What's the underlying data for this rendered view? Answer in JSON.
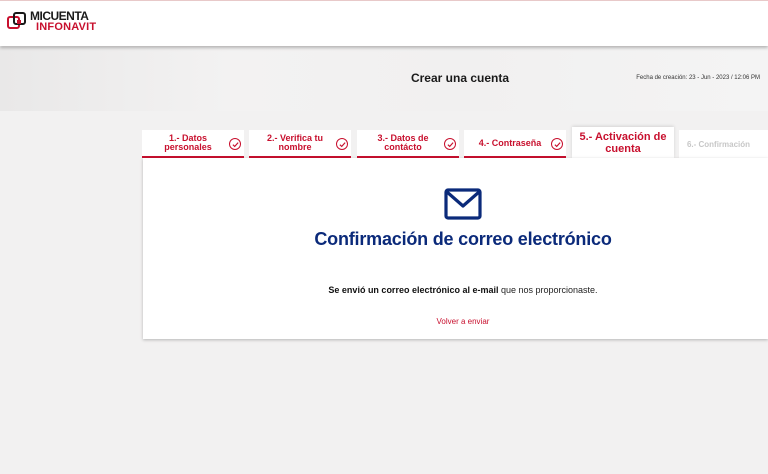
{
  "brand": {
    "line1": "MICUENTA",
    "line2": "INFONAVIT",
    "accent_color": "#c8102e"
  },
  "header": {
    "title": "Crear una cuenta",
    "creation_date": "Fecha de creación: 23 - Jun - 2023 / 12:06 PM"
  },
  "steps": [
    {
      "label": "1.- Datos personales",
      "state": "completed",
      "icon": "check-circle-icon"
    },
    {
      "label": "2.- Verifica tu nombre",
      "state": "completed",
      "icon": "check-circle-icon"
    },
    {
      "label": "3.- Datos de contácto",
      "state": "completed",
      "icon": "check-circle-icon"
    },
    {
      "label": "4.- Contraseña",
      "state": "completed",
      "icon": "check-circle-icon"
    },
    {
      "label": "5.- Activación de cuenta",
      "state": "active"
    },
    {
      "label": "6.- Confirmación",
      "state": "pending"
    }
  ],
  "confirmation": {
    "icon": "mail-icon",
    "title": "Confirmación de correo electrónico",
    "message_bold": "Se envió un correo electrónico al e-mail",
    "message_rest": " que nos proporcionaste.",
    "resend_link": "Volver a enviar",
    "title_color": "#0b2a7a"
  }
}
